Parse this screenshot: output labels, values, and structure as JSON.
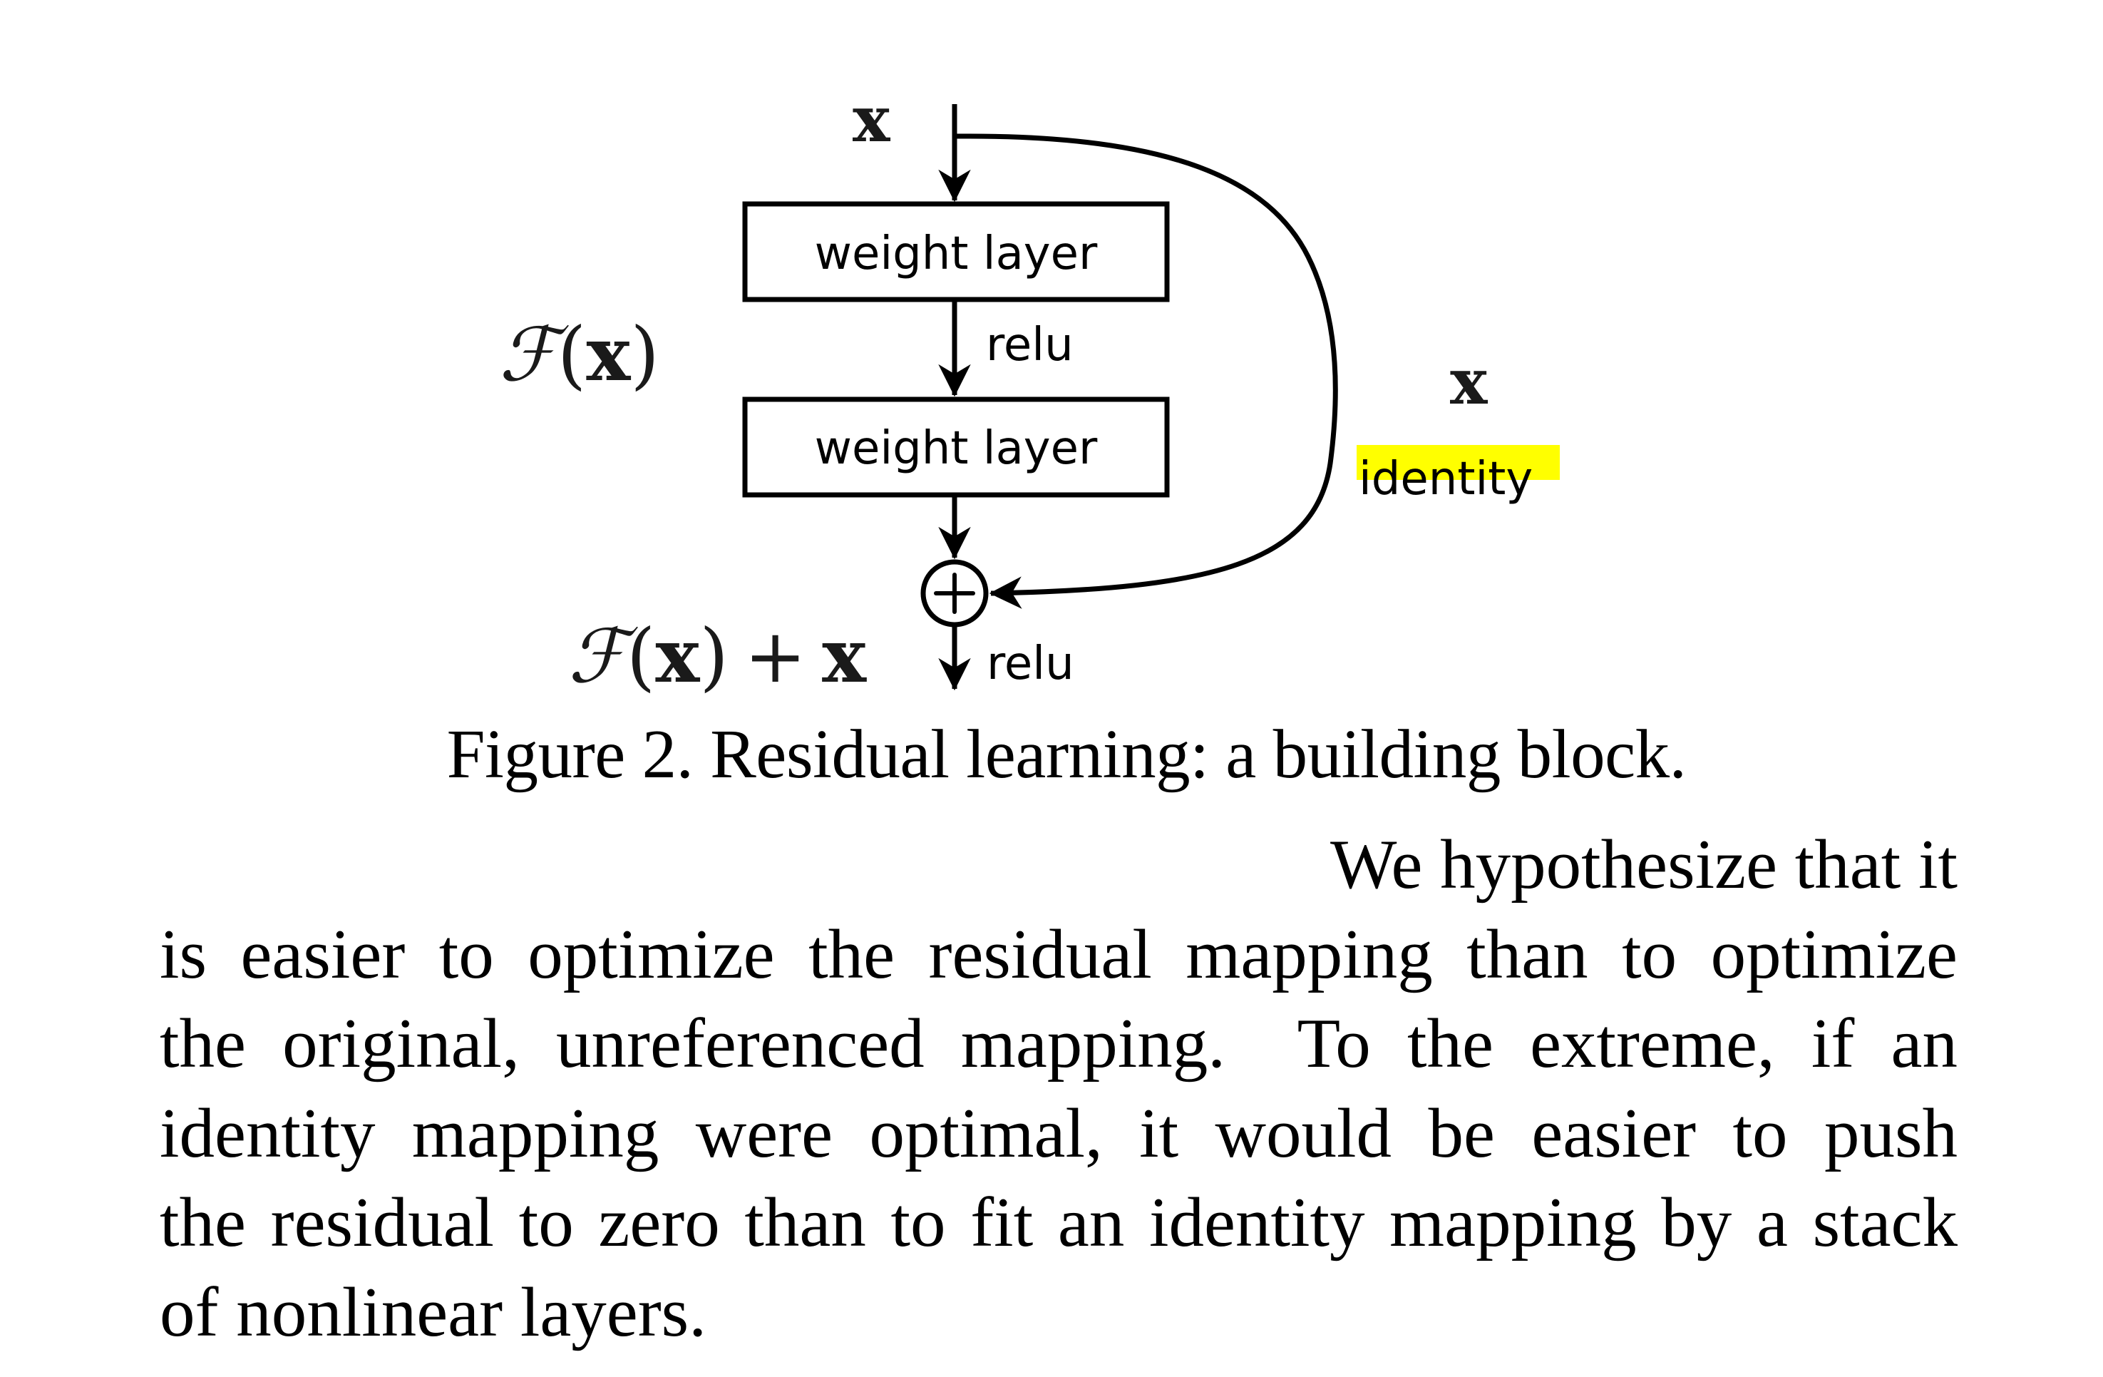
{
  "figure": {
    "input_label": "x",
    "layers": [
      {
        "label": "weight layer"
      },
      {
        "label": "weight layer"
      }
    ],
    "activation_between": "relu",
    "activation_after_sum": "relu",
    "residual_function_label": {
      "script_F": "ℱ",
      "open": "(",
      "var": "x",
      "close": ")"
    },
    "sum_label": {
      "script_F": "ℱ",
      "open": "(",
      "var": "x",
      "close": ")",
      "plus": "+",
      "var2": "x"
    },
    "sum_symbol": "plus-circle",
    "shortcut_var_label": "x",
    "shortcut_label": "identity",
    "highlight_color": "#ffff00"
  },
  "caption": "Figure 2. Residual learning: a building block.",
  "paragraph": {
    "lines": [
      "We hypothesize that it",
      "is easier to optimize the residual mapping than to optimize",
      "the original, unreferenced mapping.  To the extreme, if an",
      "identity mapping were optimal, it would be easier to push",
      "the residual to zero than to fit an identity mapping by a stack",
      "of nonlinear layers."
    ]
  }
}
